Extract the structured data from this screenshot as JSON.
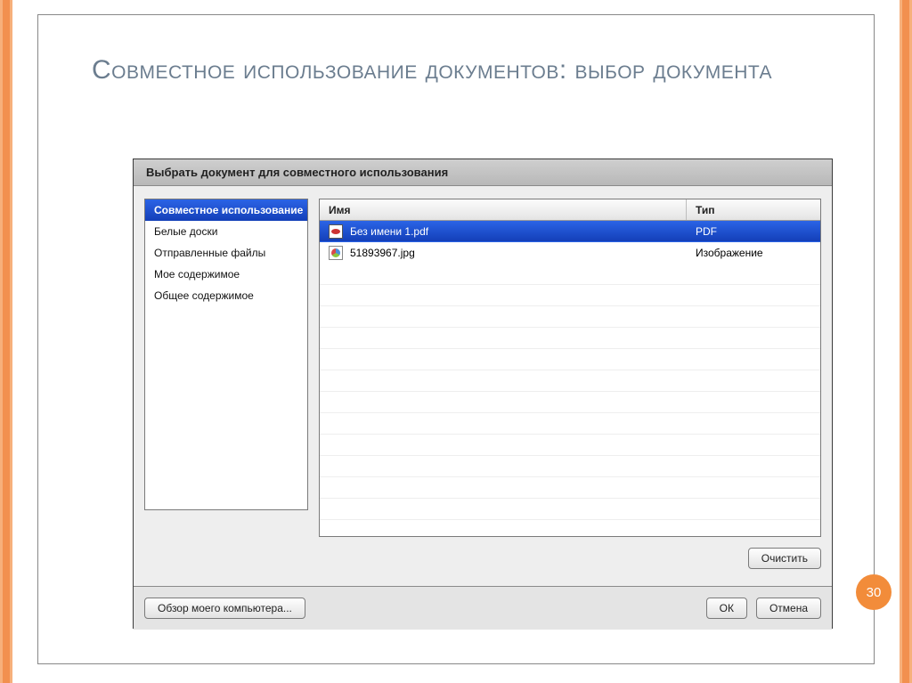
{
  "slide": {
    "title": "Совместное использование документов: выбор документа",
    "page_number": "30"
  },
  "dialog": {
    "title": "Выбрать документ для совместного использования",
    "sidebar": {
      "items": [
        {
          "label": "Совместное использование",
          "selected": true
        },
        {
          "label": "Белые доски",
          "selected": false
        },
        {
          "label": "Отправленные файлы",
          "selected": false
        },
        {
          "label": "Мое содержимое",
          "selected": false
        },
        {
          "label": "Общее содержимое",
          "selected": false
        }
      ]
    },
    "table": {
      "columns": {
        "name": "Имя",
        "type": "Тип"
      },
      "rows": [
        {
          "icon": "pdf-icon",
          "name": "Без имени 1.pdf",
          "type": "PDF",
          "selected": true
        },
        {
          "icon": "image-icon",
          "name": "51893967.jpg",
          "type": "Изображение",
          "selected": false
        }
      ]
    },
    "buttons": {
      "clear": "Очистить",
      "browse": "Обзор моего компьютера...",
      "ok": "ОК",
      "cancel": "Отмена"
    }
  }
}
